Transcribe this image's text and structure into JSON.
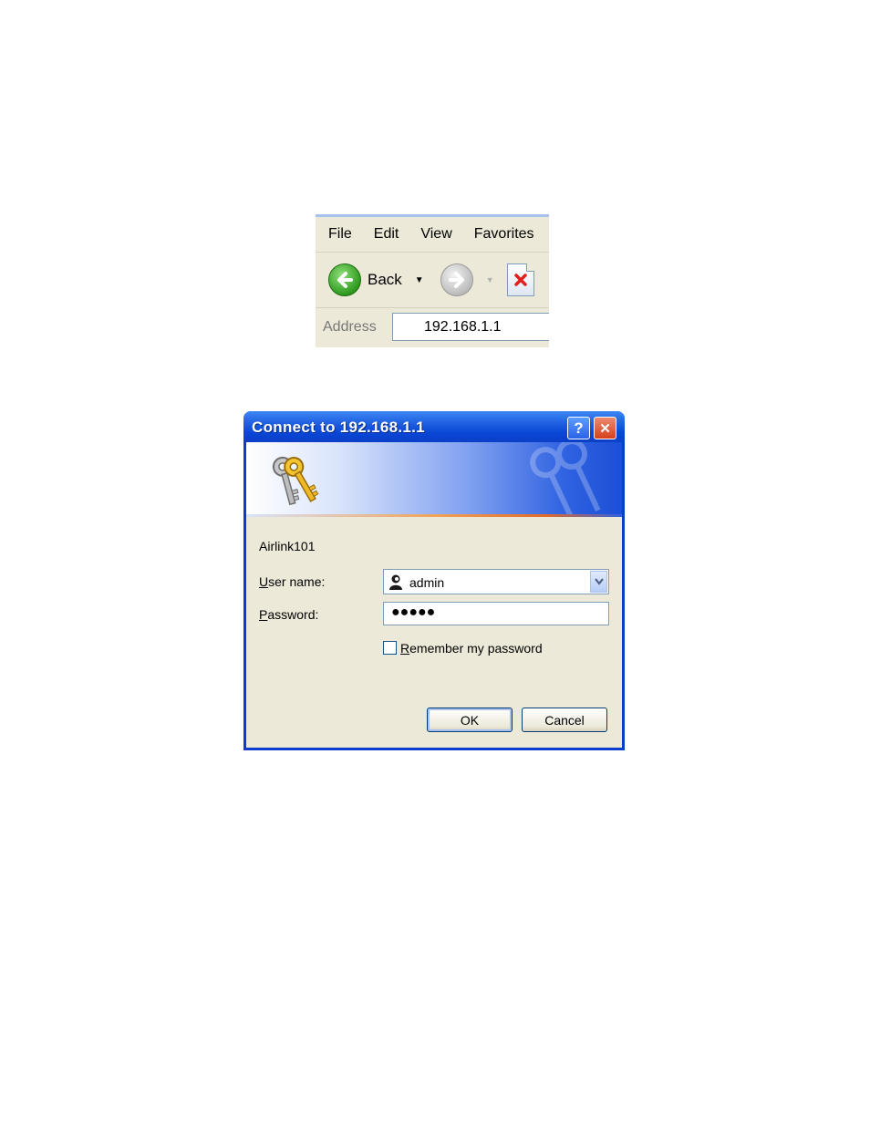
{
  "browser": {
    "menu": [
      "File",
      "Edit",
      "View",
      "Favorites"
    ],
    "back_label": "Back",
    "address_label": "Address",
    "address_value": "192.168.1.1"
  },
  "dialog": {
    "title": "Connect to 192.168.1.1",
    "help_glyph": "?",
    "close_glyph": "✕",
    "realm": "Airlink101",
    "username_label_key": "U",
    "username_label_rest": "ser name:",
    "username_value": "admin",
    "password_label_key": "P",
    "password_label_rest": "assword:",
    "password_value": "●●●●●",
    "remember_key": "R",
    "remember_rest": "emember my password",
    "remember_checked": false,
    "ok_label": "OK",
    "cancel_label": "Cancel"
  },
  "colors": {
    "titlebar": "#0a46d6",
    "dialog_body": "#ece9d8",
    "back_green": "#2f9a1f",
    "stop_red": "#e0201c"
  },
  "icons": [
    "back-arrow-icon",
    "forward-arrow-icon",
    "stop-icon",
    "keys-icon",
    "user-icon",
    "chevron-down-icon"
  ]
}
